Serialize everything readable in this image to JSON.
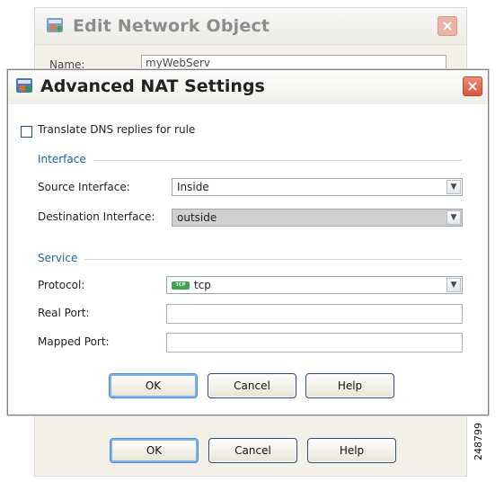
{
  "background_window": {
    "title": "Edit Network Object",
    "name_label": "Name:",
    "name_value": "myWebServ",
    "buttons": {
      "ok": "OK",
      "cancel": "Cancel",
      "help": "Help"
    }
  },
  "dialog": {
    "title": "Advanced NAT Settings",
    "translate_dns_label": "Translate DNS replies for rule",
    "translate_dns_checked": false,
    "interface_section": "Interface",
    "source_interface_label": "Source Interface:",
    "source_interface_value": "Inside",
    "destination_interface_label": "Destination Interface:",
    "destination_interface_value": "outside",
    "service_section": "Service",
    "protocol_label": "Protocol:",
    "protocol_icon_text": "TCP",
    "protocol_value": "tcp",
    "real_port_label": "Real Port:",
    "real_port_value": "",
    "mapped_port_label": "Mapped Port:",
    "mapped_port_value": "",
    "buttons": {
      "ok": "OK",
      "cancel": "Cancel",
      "help": "Help"
    }
  },
  "watermark": "248799",
  "icons": {
    "app": "network-object-icon",
    "close": "close-icon",
    "dropdown": "chevron-down-icon",
    "protocol": "tcp-icon"
  },
  "colors": {
    "section_blue": "#1a63a7",
    "close_red": "#d9573a",
    "tcp_green": "#3ea44d"
  }
}
